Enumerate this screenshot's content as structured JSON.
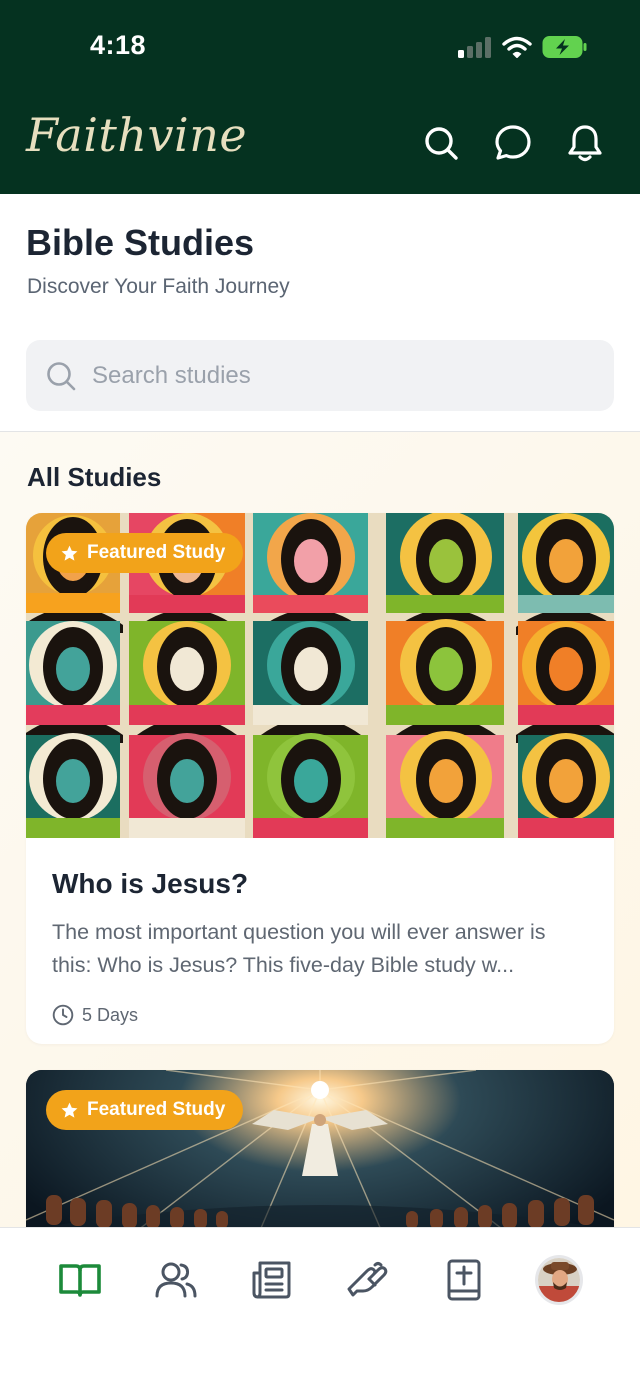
{
  "status_bar": {
    "time": "4:18"
  },
  "app": {
    "brand": "Faithvine"
  },
  "header": {
    "actions": [
      "search-icon",
      "chat-icon",
      "bell-icon"
    ]
  },
  "page": {
    "title": "Bible Studies",
    "subtitle": "Discover Your Faith Journey"
  },
  "search": {
    "placeholder": "Search studies",
    "value": ""
  },
  "section": {
    "title": "All Studies"
  },
  "studies": [
    {
      "badge": "Featured Study",
      "title": "Who is Jesus?",
      "description": "The most important question you will ever answer is this: Who is Jesus? This five-day Bible study w...",
      "duration": "5 Days"
    },
    {
      "badge": "Featured Study"
    }
  ],
  "bottom_nav": {
    "items": [
      "book-icon",
      "community-icon",
      "news-icon",
      "prayer-hands-icon",
      "bible-icon",
      "profile-avatar"
    ],
    "active_index": 0
  },
  "colors": {
    "header_bg": "#053220",
    "brand_text": "#e7dfbf",
    "accent": "#f2a31a",
    "active_nav": "#1c8a3a",
    "inactive_nav": "#4b5563"
  }
}
